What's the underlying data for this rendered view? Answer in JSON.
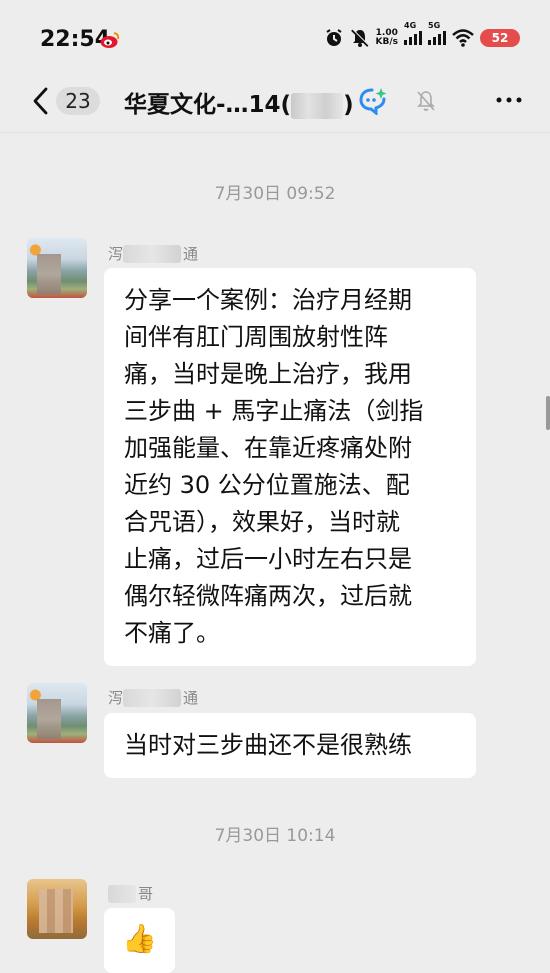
{
  "status_bar": {
    "time": "22:54",
    "net_speed_value": "1.00",
    "net_speed_unit": "KB/s",
    "signal1_label": "4G",
    "signal2_label": "5G",
    "battery": "52"
  },
  "header": {
    "unread_count": "23",
    "title": "华夏文化-…14(",
    "title_suffix": ")",
    "icons": [
      "back-icon",
      "ai-assistant-icon",
      "mute-bell-icon",
      "more-icon"
    ]
  },
  "messages": [
    {
      "type": "timestamp",
      "text": "7月30日 09:52"
    },
    {
      "type": "message",
      "sender_visible_start": "泻",
      "sender_visible_end": "通",
      "avatar": "landscape",
      "text_lines": [
        "分享一个案例：治疗月经期",
        "间伴有肛门周围放射性阵",
        "痛，当时是晚上治疗，我用",
        "三步曲 + 馬字止痛法（剑指",
        "加强能量、在靠近疼痛处附",
        "近约 30 公分位置施法、配",
        "合咒语），效果好，当时就",
        "止痛，过后一小时左右只是",
        "偶尔轻微阵痛两次，过后就",
        "不痛了。"
      ]
    },
    {
      "type": "message",
      "sender_visible_start": "泻",
      "sender_visible_end": "通",
      "avatar": "landscape",
      "text_lines": [
        "当时对三步曲还不是很熟练"
      ]
    },
    {
      "type": "timestamp",
      "text": "7月30日 10:14"
    },
    {
      "type": "message",
      "sender_visible_start": "",
      "sender_visible_end": "哥",
      "avatar": "orange",
      "emoji": "👍"
    }
  ]
}
